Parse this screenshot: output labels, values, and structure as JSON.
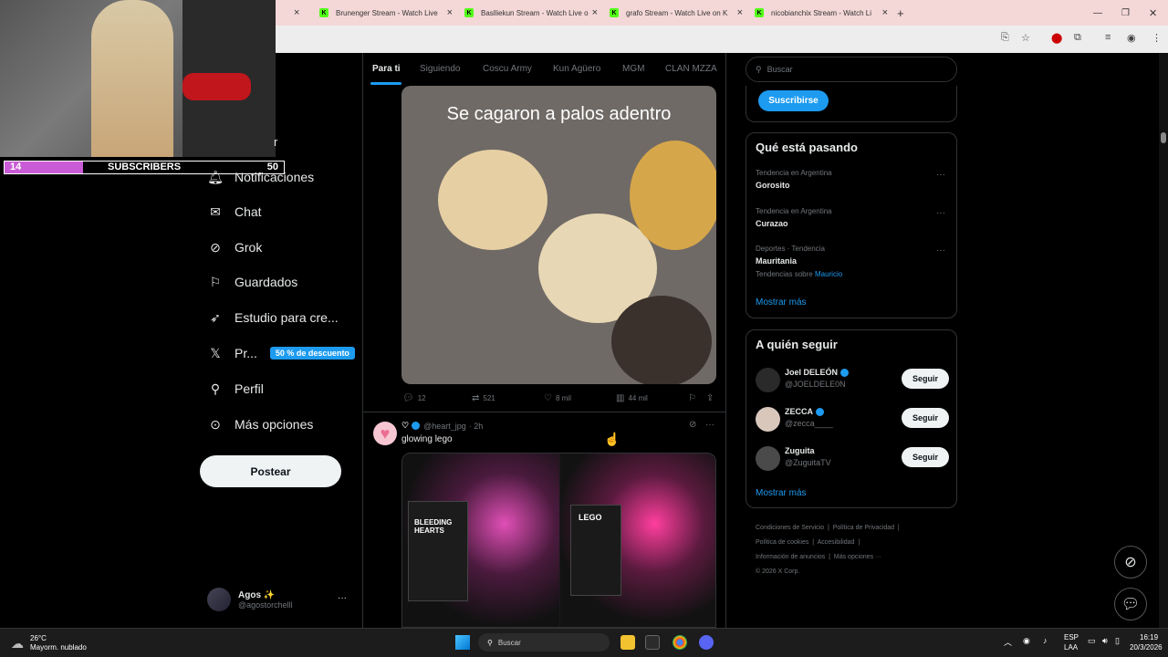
{
  "browser": {
    "tabs": [
      {
        "label": "Brunenger Stream - Watch Live"
      },
      {
        "label": "Baslliekun Stream - Watch Live o"
      },
      {
        "label": "grafo Stream - Watch Live on K"
      },
      {
        "label": "nicobianchix Stream - Watch Li"
      }
    ],
    "new_tab": "+",
    "close": "×"
  },
  "overlay": {
    "subs_current": "14",
    "subs_label": "SUBSCRIBERS",
    "subs_goal": "50",
    "subs_progress": 0.28
  },
  "nav": {
    "partial_item": "r",
    "items": [
      {
        "label": "Notificaciones",
        "icon": "bell-icon"
      },
      {
        "label": "Chat",
        "icon": "mail-icon"
      },
      {
        "label": "Grok",
        "icon": "grok-icon"
      },
      {
        "label": "Guardados",
        "icon": "bookmark-icon"
      },
      {
        "label": "Estudio para cre...",
        "icon": "rocket-icon"
      },
      {
        "label": "Pr...",
        "icon": "x-logo-icon",
        "badge": "50 % de descuento"
      },
      {
        "label": "Perfil",
        "icon": "person-icon"
      },
      {
        "label": "Más opciones",
        "icon": "more-circle-icon"
      }
    ],
    "post_button": "Postear",
    "account": {
      "name": "Agos ✨",
      "handle": "@agostorchelll",
      "more": "···"
    }
  },
  "feed": {
    "tabs": [
      "Para ti",
      "Siguiendo",
      "Coscu Army",
      "Kun Agüero",
      "MGM",
      "CLAN MZZA"
    ],
    "tweet1": {
      "image_caption": "Se cagaron a palos adentro",
      "replies": "12",
      "retweets": "521",
      "likes": "8 mil",
      "views": "44 mil"
    },
    "tweet2": {
      "name": "♡",
      "handle": "@heart_jpg",
      "time": "· 2h",
      "text": "glowing lego",
      "box1_line1": "BLEEDING",
      "box1_line2": "HEARTS",
      "box2_label": "LEGO"
    }
  },
  "sidebar": {
    "search_placeholder": "Buscar",
    "subscribe_button": "Suscribirse",
    "trends_title": "Qué está pasando",
    "trends": [
      {
        "meta": "Tendencia en Argentina",
        "name": "Gorosito"
      },
      {
        "meta": "Tendencia en Argentina",
        "name": "Curazao"
      },
      {
        "meta": "Deportes · Tendencia",
        "name": "Mauritania",
        "extra_prefix": "Tendencias sobre",
        "extra_link": "Mauricio"
      }
    ],
    "show_more": "Mostrar más",
    "follow_title": "A quién seguir",
    "follow": [
      {
        "name": "Joel DELEÓN",
        "handle": "@JOELDELE0N",
        "button": "Seguir",
        "verified": true
      },
      {
        "name": "ZECCA",
        "handle": "@zecca____",
        "button": "Seguir",
        "verified": true
      },
      {
        "name": "Zuguita",
        "handle": "@ZuguitaTV",
        "button": "Seguir",
        "verified": false
      }
    ],
    "follow_show_more": "Mostrar más",
    "footer": {
      "line1a": "Condiciones de Servicio",
      "line1b": "Política de Privacidad",
      "line2a": "Política de cookies",
      "line2b": "Accesibilidad",
      "line3a": "Información de anuncios",
      "line3b": "Más opciones ···",
      "line4": "© 2026 X Corp."
    }
  },
  "taskbar": {
    "weather_temp": "26°C",
    "weather_desc": "Mayorm. nublado",
    "search": "Buscar",
    "lang1": "ESP",
    "lang2": "LAA",
    "time": "16:19",
    "date": "20/3/2026"
  },
  "colors": {
    "accent": "#1d9bf0",
    "bg": "#000000",
    "border": "#2f3336",
    "muted": "#71767b"
  }
}
